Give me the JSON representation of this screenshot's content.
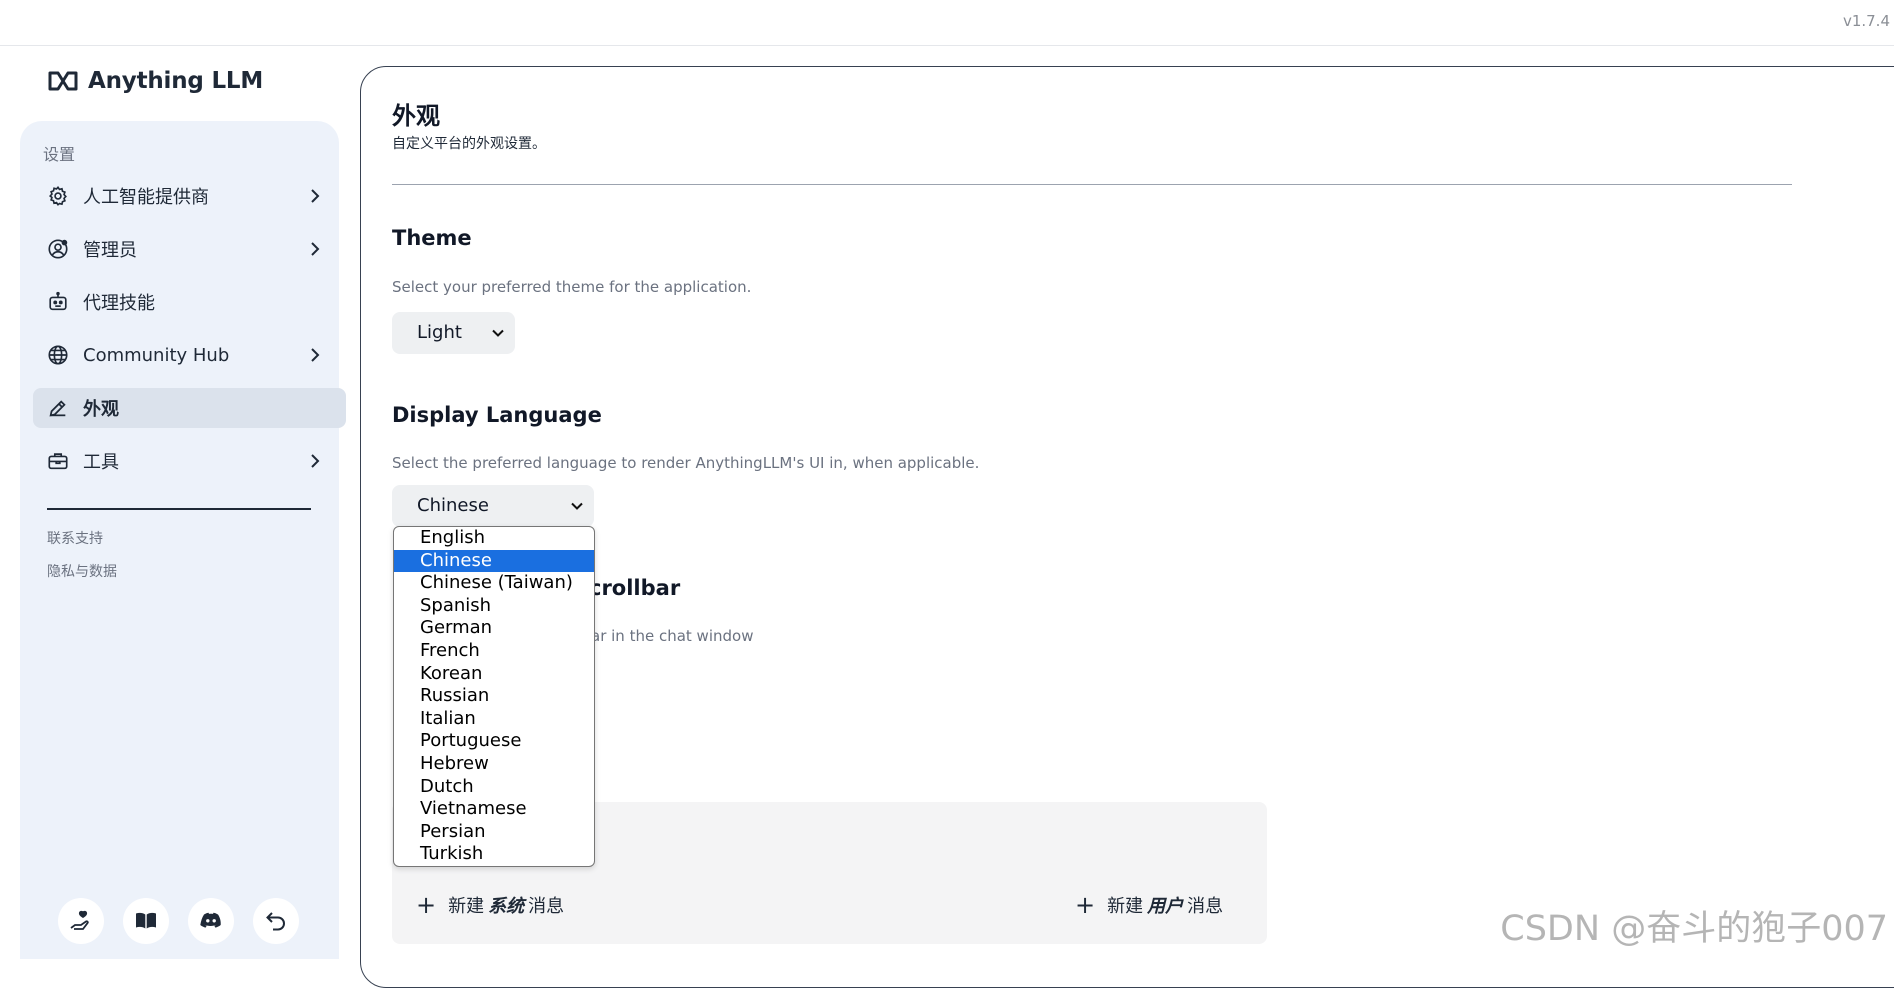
{
  "app": {
    "version": "v1.7.4",
    "logo_text": "Anything LLM"
  },
  "sidebar": {
    "heading": "设置",
    "items": [
      {
        "label": "人工智能提供商",
        "icon": "gear-icon",
        "has_chevron": true
      },
      {
        "label": "管理员",
        "icon": "user-circle-gear-icon",
        "has_chevron": true
      },
      {
        "label": "代理技能",
        "icon": "robot-icon",
        "has_chevron": false
      },
      {
        "label": "Community Hub",
        "icon": "globe-icon",
        "has_chevron": true
      },
      {
        "label": "外观",
        "icon": "pencil-icon",
        "has_chevron": false,
        "active": true
      },
      {
        "label": "工具",
        "icon": "briefcase-icon",
        "has_chevron": true
      }
    ],
    "links": {
      "support": "联系支持",
      "privacy": "隐私与数据"
    },
    "footer_icons": [
      "hand-heart-icon",
      "book-open-icon",
      "discord-icon",
      "undo-arrow-icon"
    ]
  },
  "page": {
    "title": "外观",
    "subtitle": "自定义平台的外观设置。",
    "theme": {
      "title": "Theme",
      "description": "Select your preferred theme for the application.",
      "selected": "Light"
    },
    "language": {
      "title": "Display Language",
      "description": "Select the preferred language to render AnythingLLM's UI in, when applicable.",
      "selected": "Chinese",
      "options": [
        "English",
        "Chinese",
        "Chinese (Taiwan)",
        "Spanish",
        "German",
        "French",
        "Korean",
        "Russian",
        "Italian",
        "Portuguese",
        "Hebrew",
        "Dutch",
        "Vietnamese",
        "Persian",
        "Turkish"
      ]
    },
    "scrollbar": {
      "title_fragment": "crollbar",
      "description_fragment": "ar in the chat window"
    },
    "messages": {
      "new_system": {
        "prefix": "新建",
        "bold": "系统",
        "suffix": "消息"
      },
      "new_user": {
        "prefix": "新建",
        "bold": "用户",
        "suffix": "消息"
      }
    }
  },
  "watermark": "CSDN @奋斗的狍子007",
  "colors": {
    "selected_option": "#1a6fe0",
    "sidebar_bg": "#edf2fa",
    "active_item_bg": "#dbe2ec"
  }
}
